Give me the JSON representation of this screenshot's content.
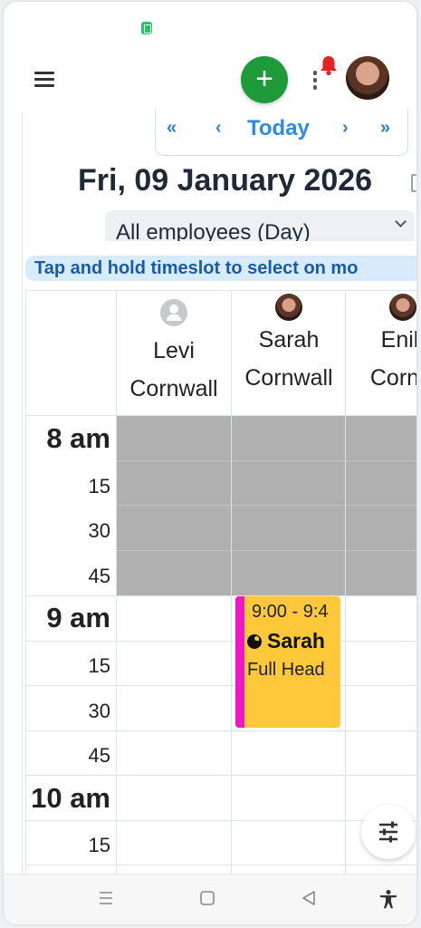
{
  "header": {
    "menu_icon": "hamburger-menu-icon",
    "add_icon": "plus-icon",
    "add_label": "+",
    "more_icon": "kebab-icon",
    "notification_icon": "bell-icon",
    "brand_color": "#1f9a3b",
    "notification_color": "#e32222"
  },
  "date_nav": {
    "first": "«",
    "prev": "‹",
    "today": "Today",
    "next": "›",
    "last": "»"
  },
  "date_title": "Fri, 09 January 2026",
  "view_select": {
    "value": "All employees (Day)"
  },
  "hint": "Tap and hold timeslot to select on mo",
  "employees": [
    {
      "first": "Levi",
      "last": "Cornwall",
      "avatar": "default-user-icon"
    },
    {
      "first": "Sarah",
      "last": "Cornwall",
      "avatar": "photo"
    },
    {
      "first": "Enik",
      "last": "Cornw",
      "avatar": "photo"
    }
  ],
  "time_slots": [
    {
      "label": "8 am",
      "hour": true
    },
    {
      "label": "15",
      "hour": false
    },
    {
      "label": "30",
      "hour": false
    },
    {
      "label": "45",
      "hour": false
    },
    {
      "label": "9 am",
      "hour": true
    },
    {
      "label": "15",
      "hour": false
    },
    {
      "label": "30",
      "hour": false
    },
    {
      "label": "45",
      "hour": false
    },
    {
      "label": "10 am",
      "hour": true
    },
    {
      "label": "15",
      "hour": false
    }
  ],
  "appointment": {
    "time": "9:00 - 9:4",
    "client": "Sarah",
    "service": "Full Head",
    "color": "#fdc93b",
    "accent": "#ee17c6"
  },
  "filter_icon": "sliders-icon",
  "bottom_nav": [
    "recent-apps-icon",
    "home-icon",
    "back-icon",
    "accessibility-icon"
  ]
}
